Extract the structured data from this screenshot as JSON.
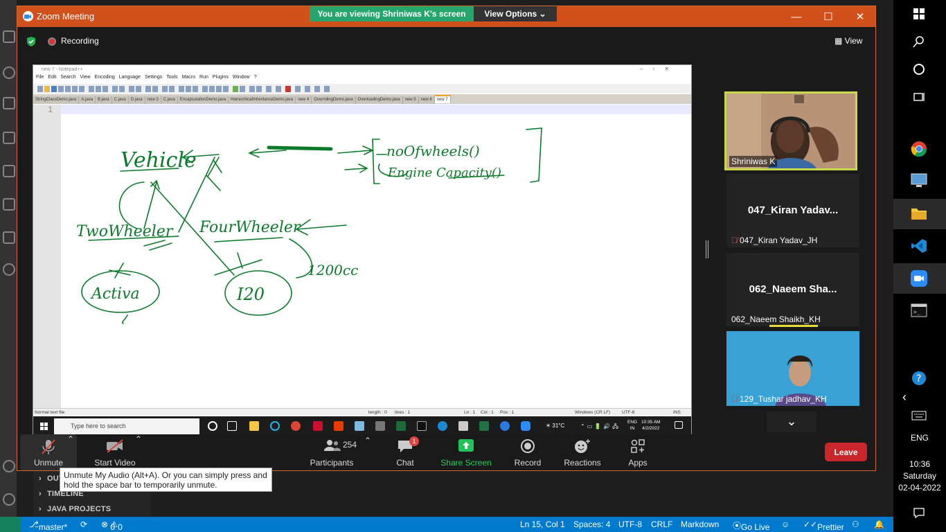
{
  "zoom": {
    "title": "Zoom Meeting",
    "banner": "You are viewing Shriniwas K's screen",
    "view_options": "View Options",
    "recording": "Recording",
    "view_label": "View"
  },
  "notepad": {
    "title": "new 7 - Notepad++",
    "menu": [
      "File",
      "Edit",
      "Search",
      "View",
      "Encoding",
      "Language",
      "Settings",
      "Tools",
      "Macro",
      "Run",
      "Plugins",
      "Window",
      "?"
    ],
    "tabs": [
      "StringClassDemo.java",
      "A.java",
      "B.java",
      "C.java",
      "D.java",
      "new 3",
      "C.java",
      "EncapsulationDemo.java",
      "HierarchicalInheritanceDemo.java",
      "new 4",
      "OverridingDemo.java",
      "OverloadingDemo.java",
      "new 5",
      "new 6",
      "new 7"
    ],
    "line_number": "1",
    "status": {
      "type": "Normal text file",
      "length": "length : 0",
      "lines": "lines : 1",
      "ln": "Ln : 1",
      "col": "Col : 1",
      "pos": "Pos : 1",
      "eol": "Windows (CR LF)",
      "enc": "UTF-8",
      "ins": "INS"
    },
    "taskbar_search": "Type here to search",
    "weather": "31°C",
    "lang": "ENG",
    "lang_region": "IN",
    "time": "10:35 AM",
    "date": "4/2/2022"
  },
  "drawing_text": {
    "vehicle": "Vehicle",
    "no_of_wheels": "noOfwheels()",
    "engine_capacity": "Engine Capacity()",
    "two_wheeler": "TwoWheeler",
    "four_wheeler": "FourWheeler",
    "activa": "Activa",
    "i20": "I20",
    "cc": "1200cc"
  },
  "participants": [
    {
      "name": "Shriniwas K",
      "big": "",
      "muted": false
    },
    {
      "name": "047_Kiran Yadav_JH",
      "big": "047_Kiran Yadav...",
      "muted": true
    },
    {
      "name": "062_Naeem Shaikh_KH",
      "big": "062_Naeem Sha...",
      "muted": false
    },
    {
      "name": "129_Tushar jadhav_KH",
      "big": "",
      "muted": true
    }
  ],
  "toolbar": {
    "unmute": "Unmute",
    "start_video": "Start Video",
    "participants": "Participants",
    "participants_count": "254",
    "chat": "Chat",
    "chat_badge": "1",
    "share_screen": "Share Screen",
    "record": "Record",
    "reactions": "Reactions",
    "apps": "Apps",
    "leave": "Leave"
  },
  "tooltip": "Unmute My Audio (Alt+A). Or you can simply press and hold the space bar to temporarily unmute.",
  "vscode": {
    "sidebar": [
      "OUT",
      "TIMELINE",
      "JAVA PROJECTS"
    ],
    "status": {
      "branch": "master*",
      "errors": "0",
      "warnings": "0",
      "cursor": "Ln 15, Col 1",
      "spaces": "Spaces: 4",
      "encoding": "UTF-8",
      "eol": "CRLF",
      "language": "Markdown",
      "golive": "Go Live",
      "prettier": "Prettier"
    }
  },
  "windows": {
    "lang": "ENG",
    "time": "10:36",
    "day": "Saturday",
    "date": "02-04-2022"
  },
  "colors": {
    "zoom_title": "#d2501c",
    "banner_green": "#26a56d",
    "leave_red": "#c9262b",
    "ink_green": "#0b7a2a",
    "vscode_blue": "#007acc"
  }
}
